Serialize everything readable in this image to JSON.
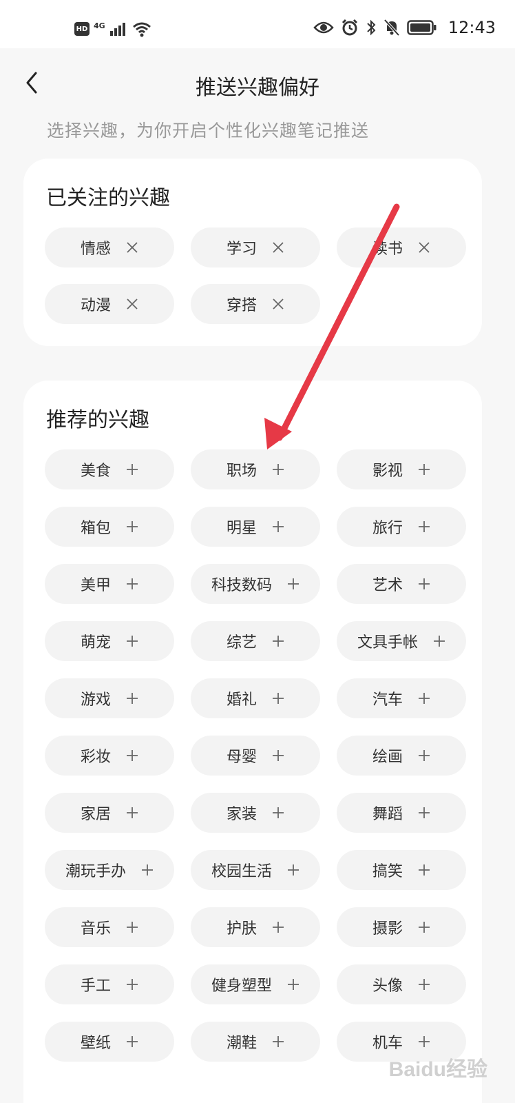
{
  "status": {
    "hd": "HD",
    "net": "4G",
    "time": "12:43"
  },
  "header": {
    "title": "推送兴趣偏好",
    "subtitle": "选择兴趣，为你开启个性化兴趣笔记推送"
  },
  "followed": {
    "title": "已关注的兴趣",
    "items": [
      "情感",
      "学习",
      "读书",
      "动漫",
      "穿搭"
    ]
  },
  "recommended": {
    "title": "推荐的兴趣",
    "items": [
      "美食",
      "职场",
      "影视",
      "箱包",
      "明星",
      "旅行",
      "美甲",
      "科技数码",
      "艺术",
      "萌宠",
      "综艺",
      "文具手帐",
      "游戏",
      "婚礼",
      "汽车",
      "彩妆",
      "母婴",
      "绘画",
      "家居",
      "家装",
      "舞蹈",
      "潮玩手办",
      "校园生活",
      "搞笑",
      "音乐",
      "护肤",
      "摄影",
      "手工",
      "健身塑型",
      "头像",
      "壁纸",
      "潮鞋",
      "机车"
    ]
  },
  "watermark": "Baidu经验",
  "colors": {
    "arrow": "#e63946",
    "tag_bg": "#f3f3f3",
    "page_bg": "#f7f7f7"
  }
}
